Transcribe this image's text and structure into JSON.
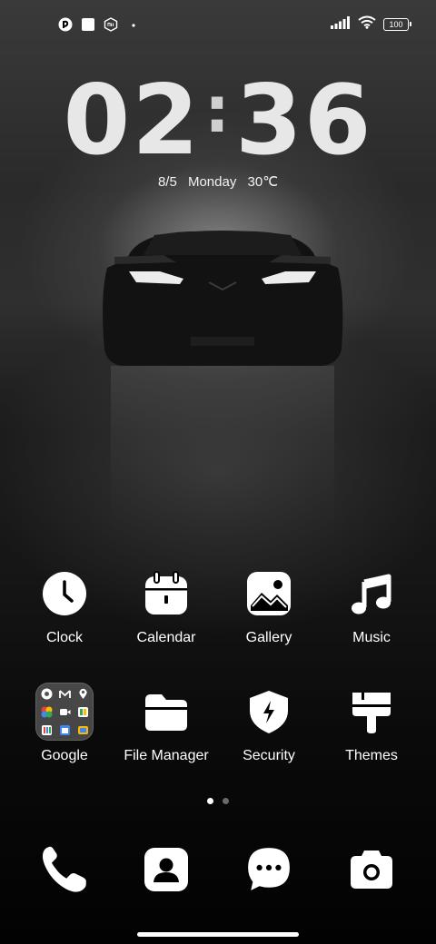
{
  "status_bar": {
    "battery_level": "100",
    "notification_icons": [
      "app-notification-icon",
      "square-notification-icon",
      "mi-notification-icon",
      "dot-indicator-icon"
    ],
    "right_icons": [
      "signal-icon",
      "wifi-icon",
      "battery-icon"
    ]
  },
  "lock_clock": {
    "hours": "02",
    "minutes": "36",
    "separator": ":"
  },
  "date_weather": {
    "date": "8/5",
    "weekday": "Monday",
    "temperature": "30℃"
  },
  "apps_row1": [
    {
      "label": "Clock",
      "icon": "clock-icon"
    },
    {
      "label": "Calendar",
      "icon": "calendar-icon"
    },
    {
      "label": "Gallery",
      "icon": "gallery-icon"
    },
    {
      "label": "Music",
      "icon": "music-icon"
    }
  ],
  "apps_row2": [
    {
      "label": "Google",
      "icon": "google-folder-icon"
    },
    {
      "label": "File Manager",
      "icon": "folder-icon"
    },
    {
      "label": "Security",
      "icon": "shield-icon"
    },
    {
      "label": "Themes",
      "icon": "paintbrush-icon"
    }
  ],
  "google_folder_apps": [
    "chrome-icon",
    "gmail-icon",
    "maps-icon",
    "photos-icon",
    "meet-icon",
    "drive-icon",
    "youtube-icon",
    "calendar-icon",
    "tv-icon"
  ],
  "pages": {
    "current": 1,
    "total": 2
  },
  "dock": [
    {
      "icon": "phone-icon"
    },
    {
      "icon": "contacts-icon"
    },
    {
      "icon": "messages-icon"
    },
    {
      "icon": "camera-icon"
    }
  ]
}
